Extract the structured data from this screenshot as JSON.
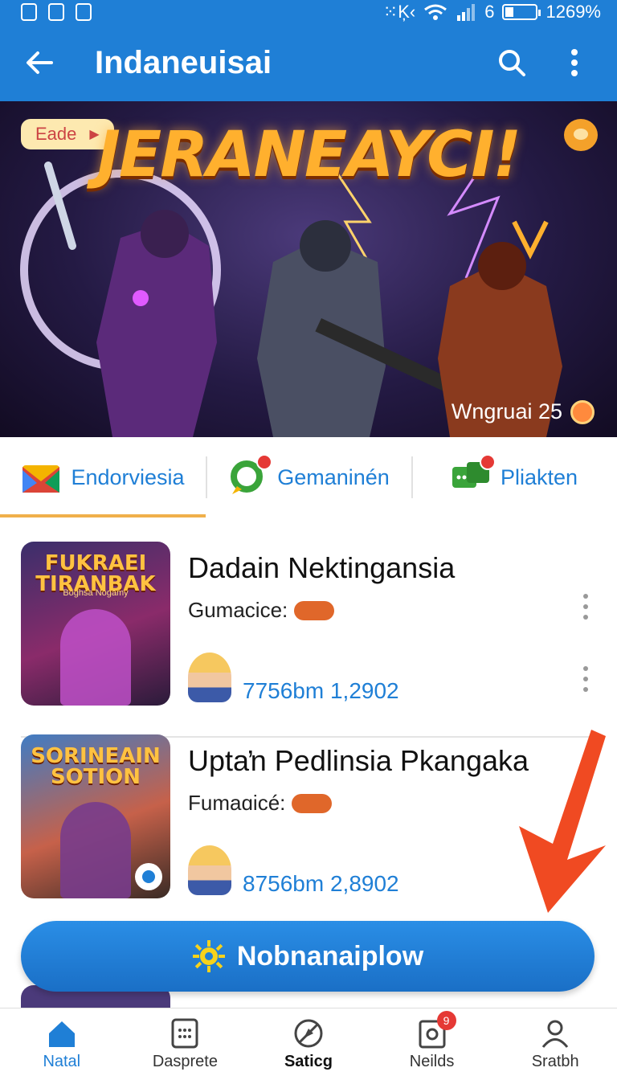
{
  "status_bar": {
    "signal_text": "⁙Ķ‹",
    "battery_level": "6",
    "battery_percent": "1269%"
  },
  "appbar": {
    "title": "Indaneuisai",
    "back_icon": "back-arrow-icon",
    "search_icon": "search-icon",
    "more_icon": "more-vert-icon"
  },
  "banner": {
    "tag": "Eade",
    "title": "JERANEAYCI!",
    "footer": "Wngruai 25"
  },
  "tabs": [
    {
      "label": "Endorviesia",
      "icon": "mail-icon",
      "active": true
    },
    {
      "label": "Gemaninén",
      "icon": "chat-bubble-icon",
      "active": false
    },
    {
      "label": "Pliakten",
      "icon": "messages-icon",
      "active": false
    }
  ],
  "items": [
    {
      "thumb_title": "FUKRAEI TIRANBAK",
      "thumb_sub": "Boghsa Nogamy",
      "title": "Dadain Nektingansia",
      "subtitle": "Gumacice:",
      "stats": "7756bm 1,2902"
    },
    {
      "thumb_title": "SORINEAIN SOTION",
      "thumb_sub": "",
      "title": "Uptaŉ Pedlinsia Pkangaka",
      "subtitle": "Fumaɑicé:",
      "stats": "8756bm 2,8902"
    }
  ],
  "cta": {
    "label": "Nobnanaiplow",
    "icon": "sun-gear-icon"
  },
  "bottom_nav": [
    {
      "label": "Natal",
      "icon": "home-icon",
      "state": "active"
    },
    {
      "label": "Dasprete",
      "icon": "grid-icon",
      "state": "normal"
    },
    {
      "label": "Saticg",
      "icon": "compass-icon",
      "state": "bold"
    },
    {
      "label": "Neilds",
      "icon": "news-icon",
      "state": "normal",
      "badge": "9"
    },
    {
      "label": "Sratbh",
      "icon": "profile-icon",
      "state": "normal"
    }
  ],
  "colors": {
    "primary": "#1f7fd6",
    "accent": "#f0b04b",
    "badge": "#e53935",
    "arrow": "#f04a22"
  }
}
